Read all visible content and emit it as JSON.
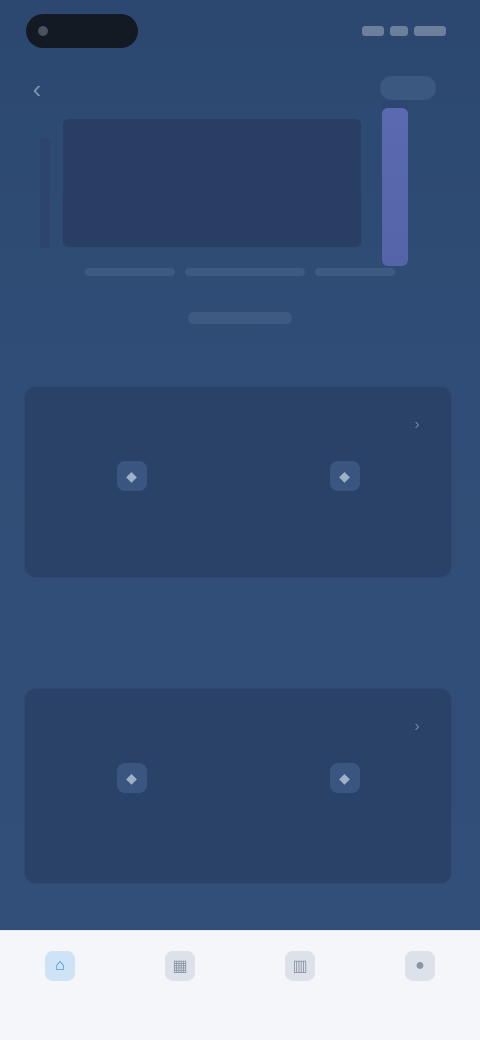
{
  "status_bar": {
    "time": "",
    "icons": [
      "signal-icon",
      "wifi-icon",
      "battery-icon"
    ]
  },
  "header": {
    "title": "",
    "back_icon": "chevron-left-icon"
  },
  "preview": {
    "level_fraction": 0.95
  },
  "card_1": {
    "title": "",
    "columns": [
      {
        "icon": "sensor-icon",
        "value": "",
        "label": ""
      },
      {
        "icon": "sensor-icon",
        "value": "",
        "label": ""
      }
    ]
  },
  "section": {
    "heading": ""
  },
  "card_2": {
    "title": "",
    "columns": [
      {
        "icon": "sensor-icon",
        "value": "",
        "label": ""
      },
      {
        "icon": "sensor-icon",
        "value": "",
        "label": ""
      }
    ]
  },
  "nav": {
    "items": [
      {
        "icon": "home-icon",
        "label": "",
        "active": true
      },
      {
        "icon": "grid-icon",
        "label": "",
        "active": false
      },
      {
        "icon": "chart-icon",
        "label": "",
        "active": false
      },
      {
        "icon": "user-icon",
        "label": "",
        "active": false
      }
    ]
  },
  "colors": {
    "background": "#2d4a72",
    "card": "#2a4268",
    "accent": "#5a6ab0",
    "nav_active": "#3f86d0",
    "nav_bg": "#f4f6f9"
  }
}
